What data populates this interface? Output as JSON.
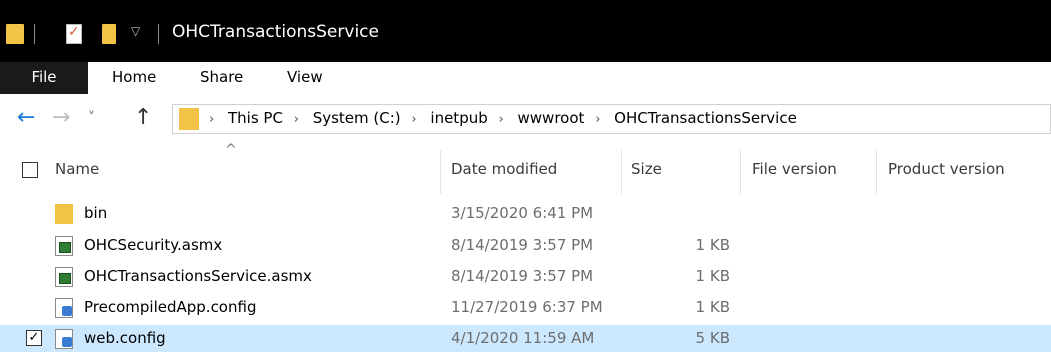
{
  "title_bar": {
    "window_title": "OHCTransactionsService",
    "icons": [
      "folder-icon",
      "properties-icon",
      "new-folder-icon",
      "customize-dropdown-icon"
    ]
  },
  "ribbon": {
    "tabs": [
      "File",
      "Home",
      "Share",
      "View"
    ]
  },
  "navigation": {
    "back_icon": "arrow-left",
    "forward_icon": "arrow-right",
    "recent_icon": "chevron-down",
    "up_icon": "arrow-up",
    "breadcrumbs": [
      "This PC",
      "System (C:)",
      "inetpub",
      "wwwroot",
      "OHCTransactionsService"
    ]
  },
  "columns": {
    "name": "Name",
    "date_modified": "Date modified",
    "size": "Size",
    "file_version": "File version",
    "product_version": "Product version"
  },
  "files": [
    {
      "name": "bin",
      "type": "folder",
      "date": "3/15/2020 6:41 PM",
      "size": ""
    },
    {
      "name": "OHCSecurity.asmx",
      "type": "asmx",
      "date": "8/14/2019 3:57 PM",
      "size": "1 KB"
    },
    {
      "name": "OHCTransactionsService.asmx",
      "type": "asmx",
      "date": "8/14/2019 3:57 PM",
      "size": "1 KB"
    },
    {
      "name": "PrecompiledApp.config",
      "type": "config",
      "date": "11/27/2019 6:37 PM",
      "size": "1 KB"
    },
    {
      "name": "web.config",
      "type": "config",
      "date": "4/1/2020 11:59 AM",
      "size": "5 KB",
      "selected": true
    }
  ],
  "colors": {
    "title_bar_bg": "#000000",
    "selection_bg": "#cce8ff",
    "folder": "#f2c347",
    "nav_accent": "#1e7ad8"
  }
}
